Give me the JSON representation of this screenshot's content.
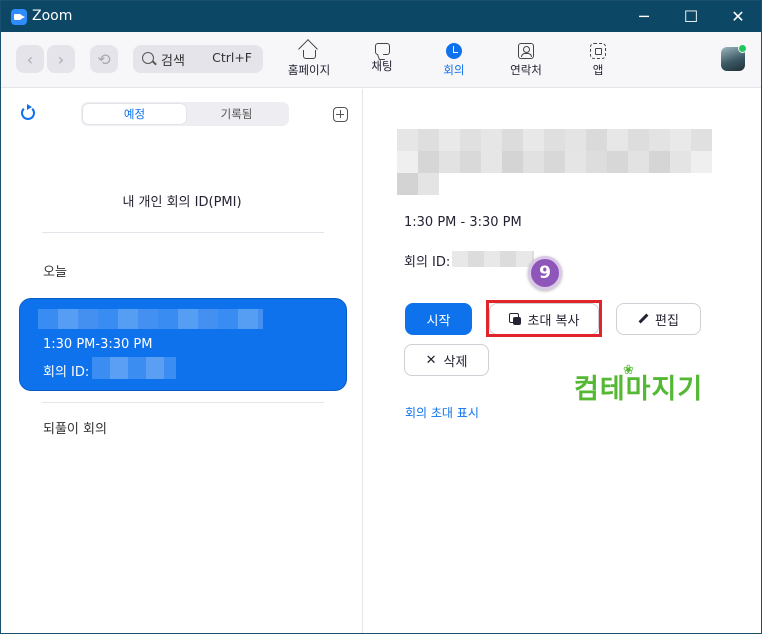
{
  "window": {
    "title": "Zoom",
    "controls": [
      "─",
      "☐",
      "✕"
    ]
  },
  "toolbar": {
    "back_glyph": "‹",
    "forward_glyph": "›",
    "history_glyph": "⟲",
    "search_label": "검색",
    "search_shortcut": "Ctrl+F",
    "tabs": [
      {
        "label": "홈페이지",
        "icon": "home-icon"
      },
      {
        "label": "채팅",
        "icon": "chat-icon"
      },
      {
        "label": "회의",
        "icon": "clock-icon",
        "active": true
      },
      {
        "label": "연락처",
        "icon": "contacts-icon"
      },
      {
        "label": "앱",
        "icon": "apps-icon"
      }
    ]
  },
  "left_panel": {
    "segments": [
      {
        "label": "예정",
        "active": true
      },
      {
        "label": "기록됨",
        "active": false
      }
    ],
    "pmi_label": "내 개인 회의 ID(PMI)",
    "today_label": "오늘",
    "meeting_card": {
      "time": "1:30 PM-3:30 PM",
      "id_label": "회의 ID:"
    },
    "recurring_label": "되풀이 회의"
  },
  "right_panel": {
    "time": "1:30 PM - 3:30 PM",
    "id_label": "회의 ID:",
    "step_badge": "9",
    "buttons": {
      "start": "시작",
      "copy_invite": "초대 복사",
      "edit": "편집",
      "delete": "삭제"
    },
    "show_invite_link": "회의 초대 표시"
  },
  "watermark": {
    "text": "컴테마지기",
    "flower": "❀"
  },
  "colors": {
    "accent": "#0e72ed",
    "titlebar": "#0c4766",
    "highlight": "#e0242a",
    "badge": "#8e56b8",
    "watermark": "#55b834"
  }
}
